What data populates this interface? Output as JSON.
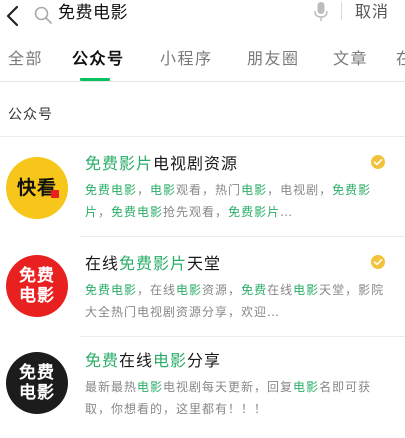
{
  "search": {
    "query": "免费电影",
    "cancel_label": "取消"
  },
  "tabs": [
    {
      "label": "全部",
      "active": false
    },
    {
      "label": "公众号",
      "active": true
    },
    {
      "label": "小程序",
      "active": false
    },
    {
      "label": "朋友圈",
      "active": false
    },
    {
      "label": "文章",
      "active": false
    },
    {
      "label": "在",
      "active": false
    }
  ],
  "section": {
    "label": "公众号"
  },
  "accent_color": "#07c160",
  "highlight_color": "#2aae67",
  "results": [
    {
      "avatar_text": "快看",
      "avatar_bg": "#f7c61a",
      "title": [
        {
          "text": "免费影片",
          "hl": true
        },
        {
          "text": "电视剧资源",
          "hl": false
        }
      ],
      "description": [
        {
          "text": "免费电影",
          "hl": true
        },
        {
          "text": "，",
          "hl": false
        },
        {
          "text": "电影",
          "hl": true
        },
        {
          "text": "观看，热门",
          "hl": false
        },
        {
          "text": "电影",
          "hl": true
        },
        {
          "text": "，电视剧，",
          "hl": false
        },
        {
          "text": "免费影片",
          "hl": true
        },
        {
          "text": "，",
          "hl": false
        },
        {
          "text": "免费电影",
          "hl": true
        },
        {
          "text": "抢先观看，",
          "hl": false
        },
        {
          "text": "免费影片",
          "hl": true
        },
        {
          "text": "…",
          "hl": false
        }
      ],
      "verified": true
    },
    {
      "avatar_text_line1": "免费",
      "avatar_text_line2": "电影",
      "avatar_bg": "#e8201f",
      "title": [
        {
          "text": "在线",
          "hl": false
        },
        {
          "text": "免费影片",
          "hl": true
        },
        {
          "text": "天堂",
          "hl": false
        }
      ],
      "description": [
        {
          "text": "免费电影",
          "hl": true
        },
        {
          "text": "，在线",
          "hl": false
        },
        {
          "text": "电影",
          "hl": true
        },
        {
          "text": "资源，",
          "hl": false
        },
        {
          "text": "免费",
          "hl": true
        },
        {
          "text": "在线",
          "hl": false
        },
        {
          "text": "电影",
          "hl": true
        },
        {
          "text": "天堂，影院大全热门电视剧资源分享，欢迎…",
          "hl": false
        }
      ],
      "verified": true
    },
    {
      "avatar_text_line1": "免费",
      "avatar_text_line2": "电影",
      "avatar_bg": "#1c1c1c",
      "title": [
        {
          "text": "免费",
          "hl": true
        },
        {
          "text": "在线",
          "hl": false
        },
        {
          "text": "电影",
          "hl": true
        },
        {
          "text": "分享",
          "hl": false
        }
      ],
      "description": [
        {
          "text": "最新最热",
          "hl": false
        },
        {
          "text": "电影",
          "hl": true
        },
        {
          "text": "电视剧每天更新，回复",
          "hl": false
        },
        {
          "text": "电影",
          "hl": true
        },
        {
          "text": "名即可获取，你想看的，这里都有！！！",
          "hl": false
        }
      ],
      "verified": false
    }
  ]
}
